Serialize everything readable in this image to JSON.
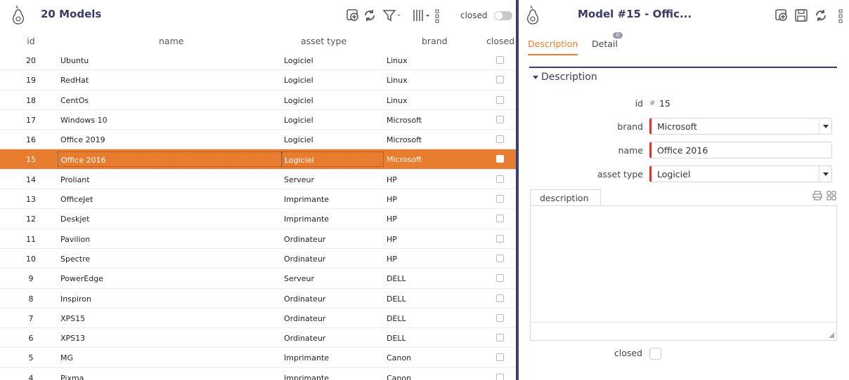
{
  "list": {
    "title": "20 Models",
    "closed_toggle_label": "closed",
    "columns": {
      "id": "id",
      "name": "name",
      "asset_type": "asset type",
      "brand": "brand",
      "closed": "closed"
    },
    "rows": [
      {
        "id": "20",
        "name": "Ubuntu",
        "asset_type": "Logiciel",
        "brand": "Linux"
      },
      {
        "id": "19",
        "name": "RedHat",
        "asset_type": "Logiciel",
        "brand": "Linux"
      },
      {
        "id": "18",
        "name": "CentOs",
        "asset_type": "Logiciel",
        "brand": "Linux"
      },
      {
        "id": "17",
        "name": "Windows 10",
        "asset_type": "Logiciel",
        "brand": "Microsoft"
      },
      {
        "id": "16",
        "name": "Office 2019",
        "asset_type": "Logiciel",
        "brand": "Microsoft"
      },
      {
        "id": "15",
        "name": "Office 2016",
        "asset_type": "Logiciel",
        "brand": "Microsoft"
      },
      {
        "id": "14",
        "name": "Proliant",
        "asset_type": "Serveur",
        "brand": "HP"
      },
      {
        "id": "13",
        "name": "OfficeJet",
        "asset_type": "Imprimante",
        "brand": "HP"
      },
      {
        "id": "12",
        "name": "Deskjet",
        "asset_type": "Imprimante",
        "brand": "HP"
      },
      {
        "id": "11",
        "name": "Pavilion",
        "asset_type": "Ordinateur",
        "brand": "HP"
      },
      {
        "id": "10",
        "name": "Spectre",
        "asset_type": "Ordinateur",
        "brand": "HP"
      },
      {
        "id": "9",
        "name": "PowerEdge",
        "asset_type": "Serveur",
        "brand": "DELL"
      },
      {
        "id": "8",
        "name": "Inspiron",
        "asset_type": "Ordinateur",
        "brand": "DELL"
      },
      {
        "id": "7",
        "name": "XPS15",
        "asset_type": "Ordinateur",
        "brand": "DELL"
      },
      {
        "id": "6",
        "name": "XPS13",
        "asset_type": "Ordinateur",
        "brand": "DELL"
      },
      {
        "id": "5",
        "name": "MG",
        "asset_type": "Imprimante",
        "brand": "Canon"
      },
      {
        "id": "4",
        "name": "Pixma",
        "asset_type": "Imprimante",
        "brand": "Canon"
      }
    ],
    "selected_id": "15"
  },
  "detail": {
    "title": "Model  #15  - Offic...",
    "tabs": {
      "description": "Description",
      "detail": "Detail",
      "detail_badge": "0"
    },
    "section_title": "Description",
    "fields": {
      "id_label": "id",
      "id_prefix": "#",
      "id_value": "15",
      "brand_label": "brand",
      "brand_value": "Microsoft",
      "name_label": "name",
      "name_value": "Office 2016",
      "asset_type_label": "asset type",
      "asset_type_value": "Logiciel",
      "description_tab": "description",
      "closed_label": "closed"
    }
  },
  "colors": {
    "accent": "#e97d2f",
    "brand": "#3d3d70",
    "required": "#dd3333"
  },
  "icons": [
    "pear-logo-icon",
    "add-icon",
    "refresh-icon",
    "filter-icon",
    "columns-icon",
    "more-icon",
    "save-icon",
    "print-icon",
    "expand-icon"
  ]
}
